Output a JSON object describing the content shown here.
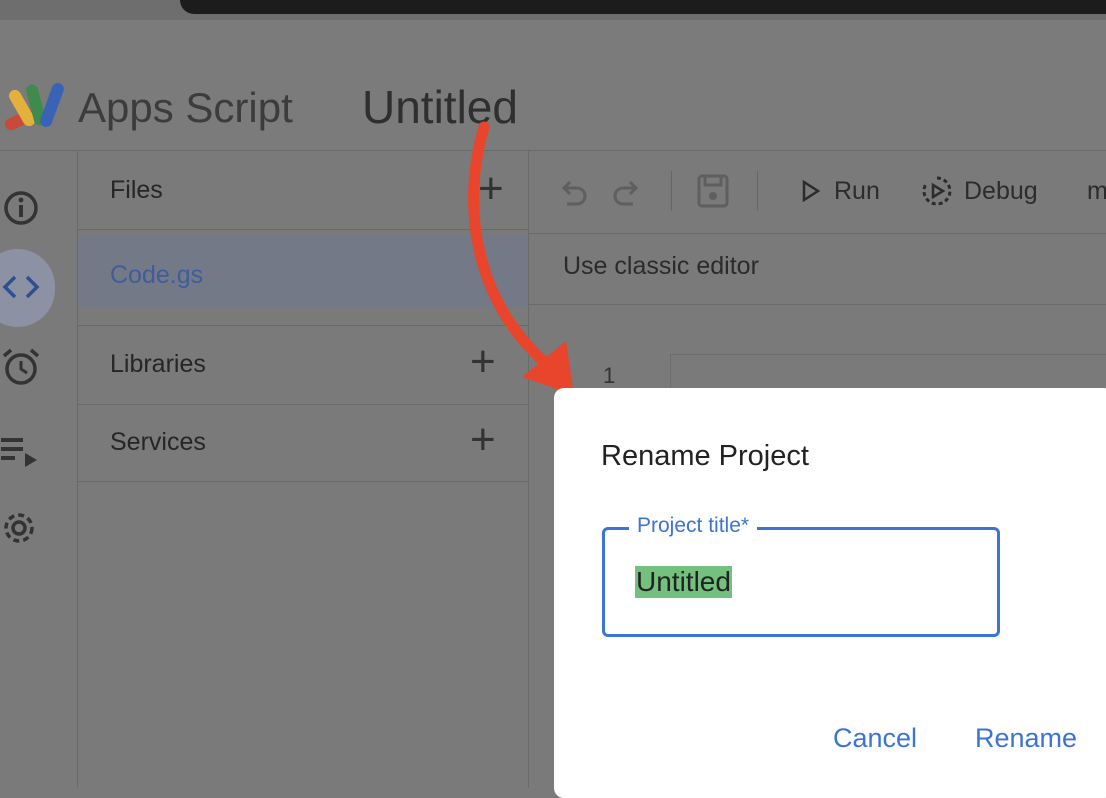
{
  "header": {
    "app_name": "Apps Script",
    "project_title": "Untitled"
  },
  "rail": {
    "icons": [
      "info-icon",
      "code-icon",
      "alarm-clock-icon",
      "executions-icon",
      "gear-icon"
    ],
    "active": "code-icon"
  },
  "files_panel": {
    "files_label": "Files",
    "file_name": "Code.gs",
    "libraries_label": "Libraries",
    "services_label": "Services"
  },
  "toolbar": {
    "run_label": "Run",
    "debug_label": "Debug",
    "overflow_text": "m"
  },
  "editor": {
    "classic_link": "Use classic editor",
    "line_number": "1"
  },
  "dialog": {
    "title": "Rename Project",
    "field_label": "Project title*",
    "field_value": "Untitled",
    "cancel_label": "Cancel",
    "rename_label": "Rename"
  },
  "colors": {
    "accent": "#3b74d6",
    "selection": "#74c07e",
    "annotation_arrow": "#e8452c"
  }
}
